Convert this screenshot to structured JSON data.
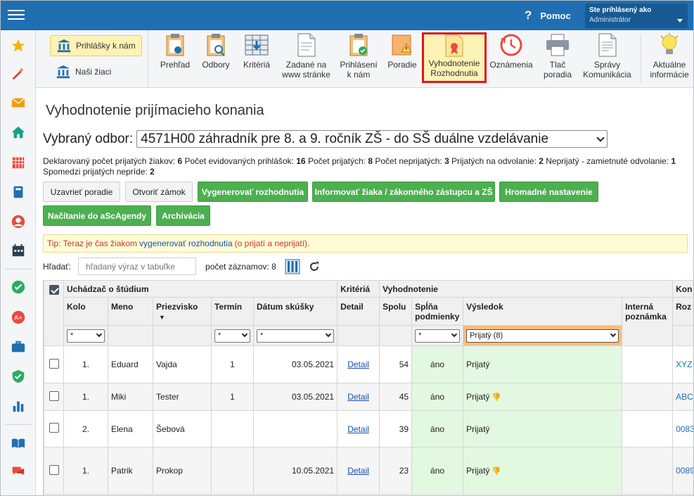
{
  "topbar": {
    "help_label": "Pomoc",
    "user_line1": "Ste prihlásený ako",
    "user_line2": "Administrátor"
  },
  "ribbon": {
    "side": [
      {
        "label": "Prihlášky k nám",
        "active": true
      },
      {
        "label": "Naši žiaci",
        "active": false
      }
    ],
    "buttons": [
      {
        "line1": "Prehľad",
        "line2": "",
        "icon": "clipboard-eye-icon"
      },
      {
        "line1": "Odbory",
        "line2": "",
        "icon": "clipboard-search-icon"
      },
      {
        "line1": "Kritériá",
        "line2": "",
        "icon": "table-icon"
      },
      {
        "line1": "Zadané na",
        "line2": "www stránke",
        "icon": "document-icon"
      },
      {
        "line1": "Prihlásení",
        "line2": "k nám",
        "icon": "clipboard-check-icon"
      },
      {
        "line1": "Poradie",
        "line2": "",
        "icon": "warning-note-icon"
      },
      {
        "line1": "Vyhodnotenie",
        "line2": "Rozhodnutia",
        "icon": "certificate-icon"
      },
      {
        "line1": "Oznámenia",
        "line2": "",
        "icon": "clock-icon"
      },
      {
        "line1": "Tlač",
        "line2": "poradia",
        "icon": "printer-icon"
      },
      {
        "line1": "Správy",
        "line2": "Komunikácia",
        "icon": "document-lines-icon"
      },
      {
        "line1": "Aktuálne",
        "line2": "informácie",
        "icon": "lightbulb-icon"
      }
    ]
  },
  "page": {
    "title": "Vyhodnotenie prijímacieho konania",
    "odbor_label": "Vybraný odbor:",
    "odbor_value": "4571H00 záhradník pre 8. a 9. ročník ZŠ - do SŠ duálne vzdelávanie"
  },
  "stats": {
    "l1": "Deklarovaný počet prijatých žiakov:",
    "v1": "6",
    "l2": "Počet evidovaných prihlášok:",
    "v2": "16",
    "l3": "Počet prijatých:",
    "v3": "8",
    "l4": "Počet neprijatých:",
    "v4": "3",
    "l5": "Prijatých na odvolanie:",
    "v5": "2",
    "l6": "Neprijatý - zamietnuté odvolanie:",
    "v6": "1",
    "l7": "Spomedzi prijatých neprí­de:",
    "v7": "2"
  },
  "actions": {
    "uzavriet": "Uzavrieť poradie",
    "otvorit": "Otvoriť zámok",
    "generovat": "Vygenerovať rozhodnutia",
    "informovat": "Informovať žiaka / zákonného zástupcu a ZŠ",
    "hromadne": "Hromadné nastavenie",
    "nacitanie": "Načítanie do aScAgendy",
    "archivacia": "Archivácia"
  },
  "tip": {
    "prefix": "Tip: Teraz je čas žiakom",
    "link": "vygenerovať rozhodnutia",
    "suffix": "(o prijatí a neprijatí)."
  },
  "search": {
    "label": "Hľadať:",
    "placeholder": "hľadaný výraz v tabuľke",
    "count_label": "počet záznamov: 8"
  },
  "table": {
    "groups": {
      "uchadzac": "Uchádzač o štúdium",
      "kriteria": "Kritériá",
      "vyhodnotenie": "Vyhodnotenie",
      "kon": "Kon"
    },
    "columns": {
      "kolo": "Kolo",
      "meno": "Meno",
      "priezvisko": "Priezvisko",
      "termin": "Termín",
      "datum": "Dátum skúšky",
      "detail": "Detail",
      "spolu": "Spolu",
      "splna": "Spĺňa podmienky",
      "vysledok": "Výsledok",
      "interna": "Interná poznámka",
      "roz": "Roz"
    },
    "filters": {
      "kolo": "*",
      "termin": "*",
      "datum": "*",
      "splna": "*",
      "vysledok": "Prijatý (8)"
    },
    "rows": [
      {
        "kolo": "1.",
        "meno": "Eduard",
        "priezvisko": "Vajda",
        "termin": "1",
        "datum": "03.05.2021",
        "detail": "Detail",
        "spolu": "54",
        "splna": "áno",
        "vysledok": "Prijatý",
        "thumb": "",
        "kod": "XYZ"
      },
      {
        "kolo": "1.",
        "meno": "Miki",
        "priezvisko": "Tester",
        "termin": "1",
        "datum": "03.05.2021",
        "detail": "Detail",
        "spolu": "45",
        "splna": "áno",
        "vysledok": "Prijatý",
        "thumb": "👎",
        "kod": "ABC"
      },
      {
        "kolo": "2.",
        "meno": "Elena",
        "priezvisko": "Šebová",
        "termin": "",
        "datum": "",
        "detail": "Detail",
        "spolu": "39",
        "splna": "áno",
        "vysledok": "Prijatý",
        "thumb": "",
        "kod": "0083"
      },
      {
        "kolo": "1.",
        "meno": "Patrik",
        "priezvisko": "Prokop",
        "termin": "",
        "datum": "10.05.2021",
        "detail": "Detail",
        "spolu": "23",
        "splna": "áno",
        "vysledok": "Prijatý",
        "thumb": "👎",
        "kod": "0089"
      }
    ]
  }
}
